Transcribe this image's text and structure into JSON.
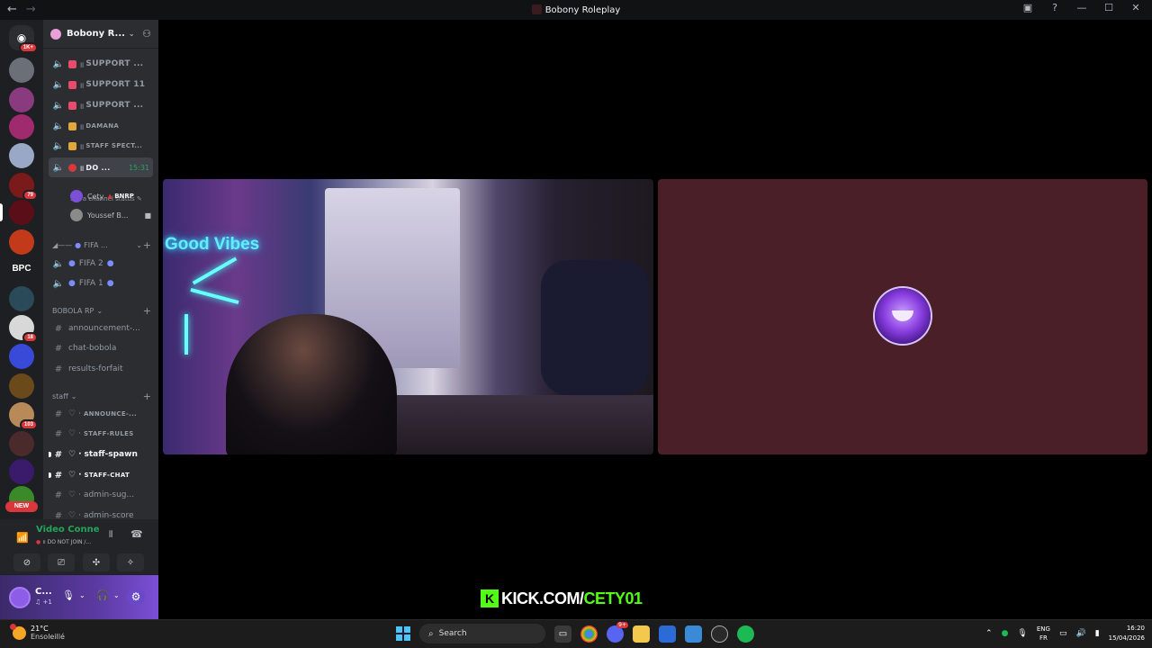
{
  "window": {
    "title": "Bobony Roleplay"
  },
  "servers": {
    "home_badge": "1K+",
    "bpc_label": "BPC",
    "badges": [
      "79",
      "18",
      "103"
    ],
    "new_label": "NEW"
  },
  "guild": {
    "name": "Bobony R..."
  },
  "channels": {
    "voice": [
      {
        "name": "SUPPORT ...",
        "prefix": "॥"
      },
      {
        "name": "SUPPORT 11",
        "prefix": "॥"
      },
      {
        "name": "SUPPORT ...",
        "prefix": "॥"
      },
      {
        "name": "DAMANA",
        "prefix": "॥"
      },
      {
        "name": "STAFF SPECT...",
        "prefix": "॥"
      }
    ],
    "active": {
      "name": "DO ...",
      "prefix": "॥",
      "time": "15:31",
      "status": "Set a channel status"
    },
    "members": [
      {
        "name": "Cety",
        "tag": "BNRP"
      },
      {
        "name": "Youssef B..."
      }
    ],
    "fifa_category": "FIFA ...",
    "fifa": [
      "FIFA 2",
      "FIFA 1"
    ],
    "cat_bobola": "BOBOLA RP",
    "bobola": [
      "announcement-...",
      "chat-bobola",
      "results-forfait"
    ],
    "cat_staff": "staff",
    "staff": [
      "ANNOUNCE-...",
      "STAFF-RULES",
      "staff-spawn",
      "STAFF-CHAT",
      "admin-sug...",
      "admin-score"
    ]
  },
  "voice_panel": {
    "title": "Video Connected",
    "sub": "॥ DO NOT JOIN /..."
  },
  "user_panel": {
    "name": "C...",
    "sub": "♫ +1"
  },
  "stage": {
    "kick_prefix": "KICK.COM/",
    "kick_user": "CETY01",
    "neon_text": "Good Vibes"
  },
  "taskbar": {
    "temp": "21°C",
    "weather": "Ensoleillé",
    "search": "Search",
    "discord_badge": "9+",
    "lang1": "ENG",
    "lang2": "FR",
    "time": "16:20",
    "date": "15/04/2026"
  }
}
